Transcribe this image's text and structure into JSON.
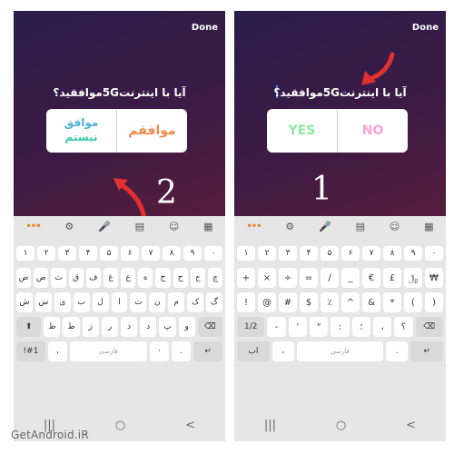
{
  "left": {
    "done": "Done",
    "question": "آیا با اینترنت5Gموافقید؟",
    "option_right": "موافقم",
    "option_left_line1": "موافق",
    "option_left_line2": "نیستم",
    "step": "2",
    "kb": {
      "toolbar": [
        "•••",
        "⚙",
        "🎤",
        "▤",
        "☺",
        "▦"
      ],
      "numbers": [
        "۱",
        "۲",
        "۳",
        "۴",
        "۵",
        "۶",
        "۷",
        "۸",
        "۹",
        "۰"
      ],
      "row1": [
        "ض",
        "ص",
        "ث",
        "ق",
        "ف",
        "غ",
        "ع",
        "ه",
        "خ",
        "ح",
        "ج",
        "چ"
      ],
      "row2": [
        "ش",
        "س",
        "ی",
        "ب",
        "ل",
        "ا",
        "ت",
        "ن",
        "م",
        "ک",
        "گ"
      ],
      "row3": [
        "⬆",
        "ظ",
        "ط",
        "ز",
        "ر",
        "ذ",
        "د",
        "پ",
        "و",
        "⌫"
      ],
      "row4": [
        "!#1",
        "،",
        "فارسی",
        "‧",
        "."
      ],
      "nav": [
        "|||",
        "○",
        "<"
      ]
    }
  },
  "right": {
    "done": "Done",
    "question": "آیا با اینترنت5Gموافقید؟",
    "option_left": "YES",
    "option_right": "NO",
    "step": "1",
    "kb": {
      "toolbar": [
        "•••",
        "⚙",
        "🎤",
        "▤",
        "☺",
        "▦"
      ],
      "numbers": [
        "۱",
        "۲",
        "۳",
        "۴",
        "۵",
        "۶",
        "۷",
        "۸",
        "۹",
        "۰"
      ],
      "row1": [
        "+",
        "×",
        "÷",
        "=",
        "/",
        "_",
        "€",
        "£",
        "﷼",
        "₩"
      ],
      "row2": [
        "!",
        "@",
        "#",
        "$",
        "٪",
        "^",
        "&",
        "*",
        "(",
        ")"
      ],
      "row3": [
        "1/2",
        "-",
        "'",
        "\"",
        ":",
        "؛",
        "،",
        "؟",
        "⌫"
      ],
      "row4": [
        "اب",
        "،",
        "فارسی",
        "."
      ],
      "nav": [
        "|||",
        "○",
        "<"
      ]
    }
  },
  "watermark": "GetAndroid.iR",
  "colors": {
    "yes": "#8ee8a4",
    "no": "#f6a4d4",
    "agree": "#ee8a4a",
    "arrow": "#e23030"
  }
}
